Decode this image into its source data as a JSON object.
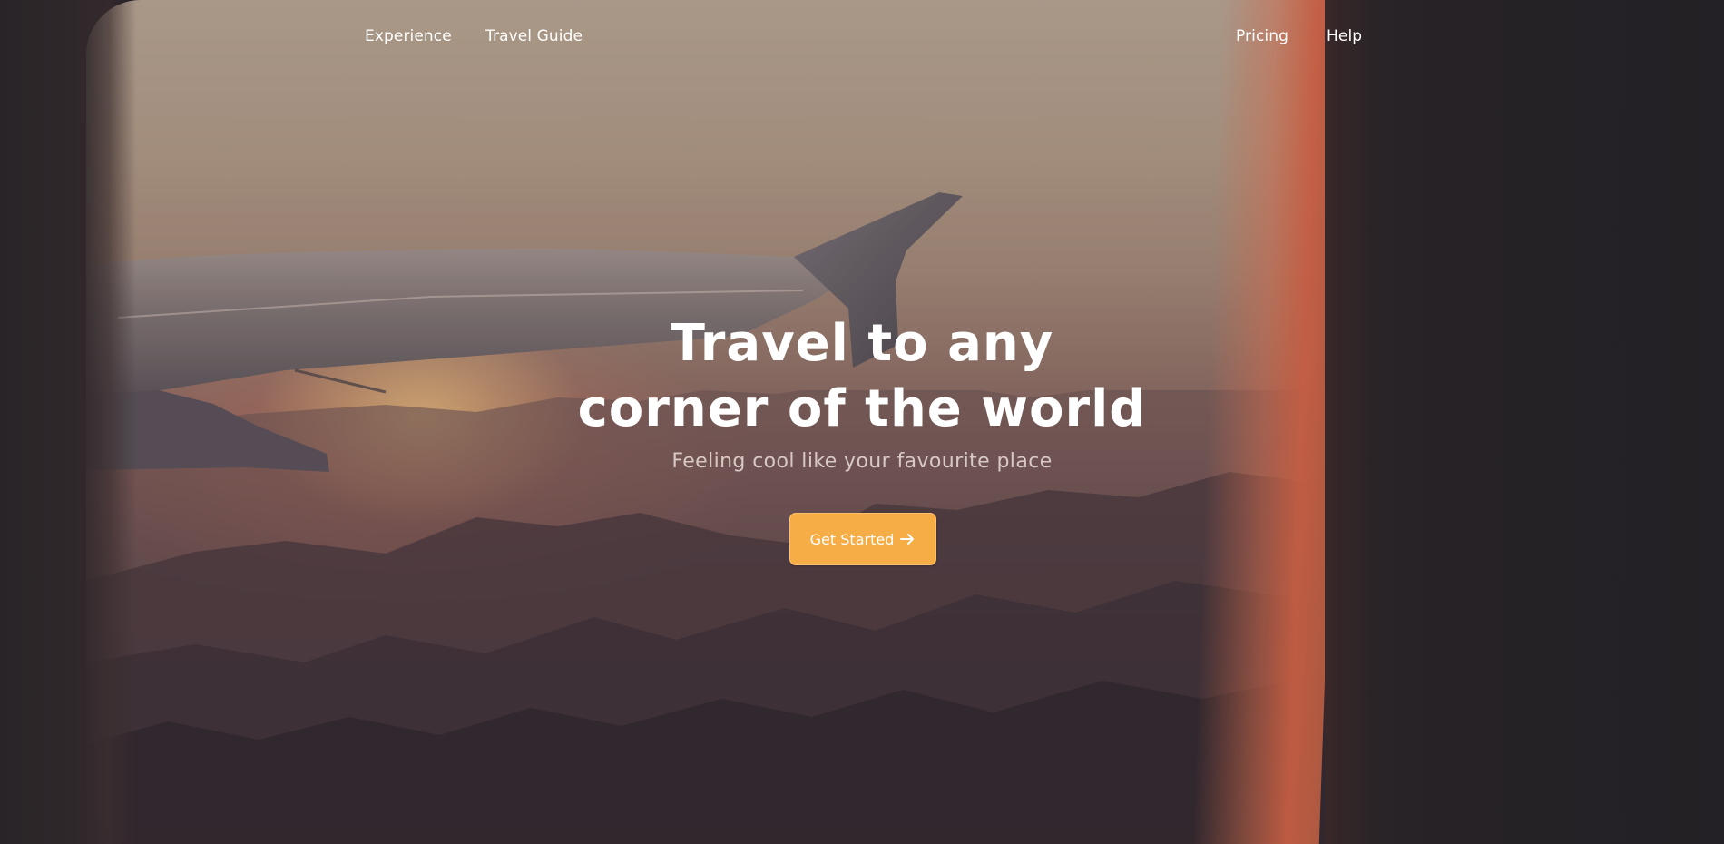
{
  "nav": {
    "experience": "Experience",
    "travel_guide": "Travel Guide",
    "pricing": "Pricing",
    "help": "Help"
  },
  "hero": {
    "title_line_1": "Travel to any",
    "title_line_2": "corner of the world",
    "subtitle": "Feeling cool like your favourite place",
    "cta_label": "Get Started",
    "cta_icon": "arrow-right-icon"
  },
  "colors": {
    "accent": "#f6ad45",
    "text": "#ffffff",
    "subtitle": "#d8c9c7",
    "background_dark": "#232126"
  }
}
